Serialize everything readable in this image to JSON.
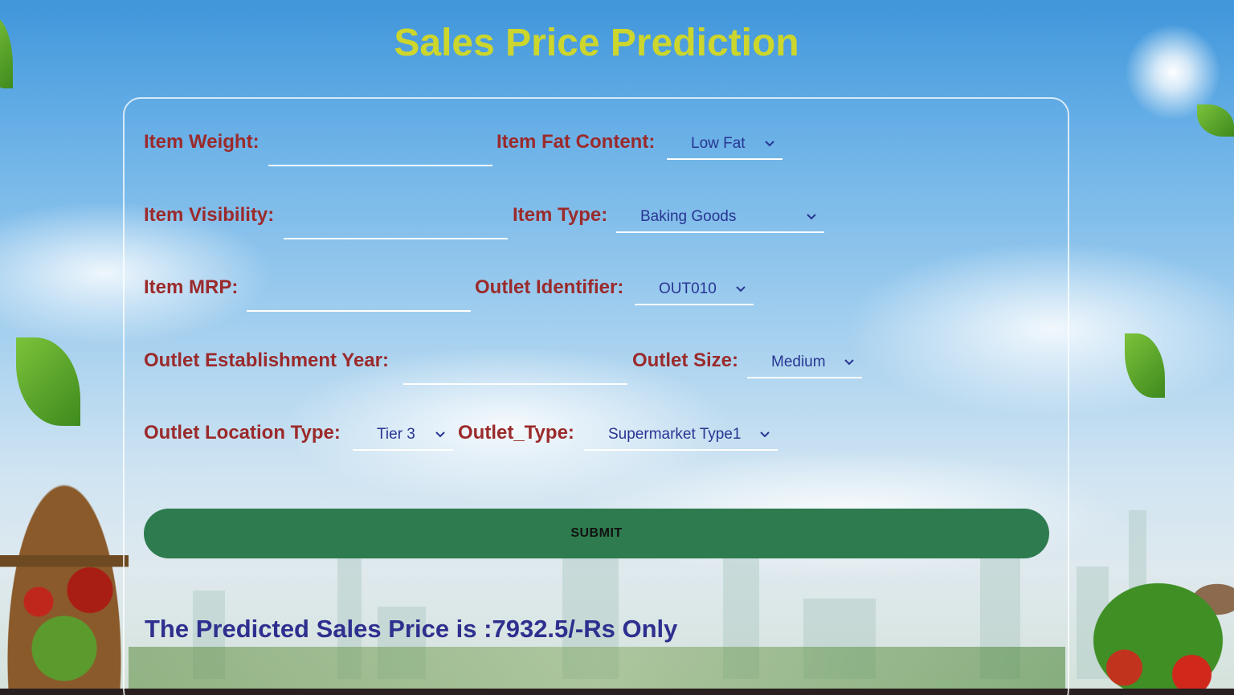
{
  "page": {
    "title": "Sales Price Prediction"
  },
  "form": {
    "item_weight": {
      "label": "Item Weight:",
      "value": ""
    },
    "item_fat_content": {
      "label": "Item Fat Content:",
      "selected": "Low Fat"
    },
    "item_visibility": {
      "label": "Item Visibility:",
      "value": ""
    },
    "item_type": {
      "label": "Item Type:",
      "selected": "Baking Goods"
    },
    "item_mrp": {
      "label": "Item MRP:",
      "value": ""
    },
    "outlet_identifier": {
      "label": "Outlet Identifier:",
      "selected": "OUT010"
    },
    "outlet_establishment_year": {
      "label": "Outlet Establishment Year:",
      "value": ""
    },
    "outlet_size": {
      "label": "Outlet Size:",
      "selected": "Medium"
    },
    "outlet_location_type": {
      "label": "Outlet Location Type:",
      "selected": "Tier 3"
    },
    "outlet_type": {
      "label": "Outlet_Type:",
      "selected": "Supermarket Type1"
    },
    "submit_label": "SUBMIT"
  },
  "result": {
    "text": "The Predicted Sales Price is :7932.5/-Rs Only"
  },
  "colors": {
    "title": "#cdd62c",
    "label": "#9b2a2b",
    "select_text": "#283593",
    "submit_bg": "#2e7b4f",
    "result": "#2f2f8f"
  },
  "icons": {
    "select_chevron": "chevron-down-icon"
  }
}
